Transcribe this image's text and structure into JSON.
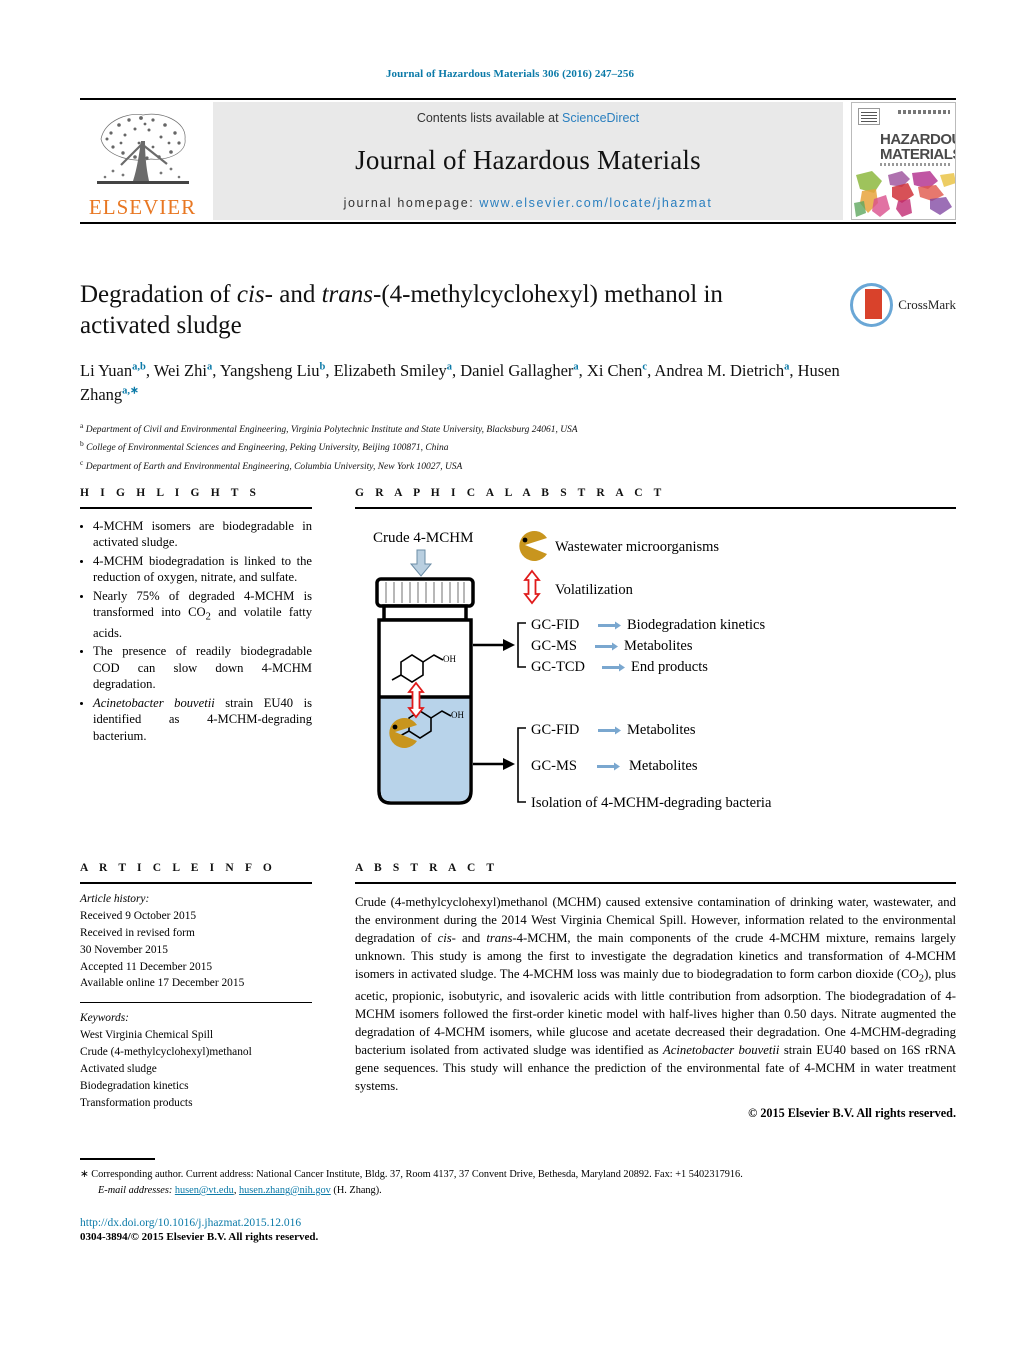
{
  "running_head": "Journal of Hazardous Materials 306 (2016) 247–256",
  "masthead": {
    "contents_prefix": "Contents lists available at ",
    "contents_link": "ScienceDirect",
    "journal_title": "Journal of Hazardous Materials",
    "homepage_label": "journal homepage: ",
    "homepage_url": "www.elsevier.com/locate/jhazmat",
    "publisher": "ELSEVIER",
    "cover_line1": "HAZARDOUS",
    "cover_line2": "MATERIALS"
  },
  "article": {
    "title_part1": "Degradation of ",
    "title_cis": "cis",
    "title_part2": "- and ",
    "title_trans": "trans",
    "title_part3": "-(4-methylcyclohexyl) methanol in activated sludge",
    "crossmark_label": "CrossMark",
    "authors_html": "Li Yuan<sup>a,b</sup>, Wei Zhi<sup>a</sup>, Yangsheng Liu<sup>b</sup>, Elizabeth Smiley<sup>a</sup>, Daniel Gallagher<sup>a</sup>, Xi Chen<sup>c</sup>, Andrea M. Dietrich<sup>a</sup>, Husen Zhang<sup>a,∗</sup>",
    "affiliations": [
      "Department of Civil and Environmental Engineering, Virginia Polytechnic Institute and State University, Blacksburg 24061, USA",
      "College of Environmental Sciences and Engineering, Peking University, Beijing 100871, China",
      "Department of Earth and Environmental Engineering, Columbia University, New York 10027, USA"
    ],
    "affil_marks": [
      "a",
      "b",
      "c"
    ]
  },
  "highlights": {
    "heading": "H I G H L I G H T S",
    "items_html": [
      "4-MCHM isomers are biodegradable in activated sludge.",
      "4-MCHM biodegradation is linked to the reduction of oxygen, nitrate, and sulfate.",
      "Nearly 75% of degraded 4-MCHM is transformed into CO<sub>2</sub> and volatile fatty acids.",
      "The presence of readily biodegradable COD can slow down 4-MCHM degradation.",
      "<i>Acinetobacter bouvetii</i> strain EU40 is identified as 4-MCHM-degrading bacterium."
    ]
  },
  "graphical_abstract": {
    "heading": "G R A P H I C A L   A B S T R A C T",
    "input_label": "Crude 4-MCHM",
    "legend": [
      {
        "icon": "pacman-microbe-icon",
        "label": "Wastewater microorganisms"
      },
      {
        "icon": "double-arrow-icon",
        "label": "Volatilization"
      }
    ],
    "headspace_analyses": [
      {
        "method": "GC-FID",
        "result": "Biodegradation kinetics"
      },
      {
        "method": "GC-MS",
        "result": "Metabolites"
      },
      {
        "method": "GC-TCD",
        "result": "End products"
      }
    ],
    "liquid_analyses": [
      {
        "method": "GC-FID",
        "result": "Metabolites"
      },
      {
        "method": "GC-MS",
        "result": "Metabolites"
      }
    ],
    "liquid_extra": "Isolation of 4-MCHM-degrading bacteria",
    "molecule_label": "OH",
    "colors": {
      "liquid": "#b8d3ea",
      "microbe": "#c8951e",
      "volatilization_arrow": "#e01b1b",
      "input_arrow": "#b9cfe0",
      "result_arrow": "#7aa7cf"
    }
  },
  "article_info": {
    "heading": "A R T I C L E   I N F O",
    "history_label": "Article history:",
    "history": [
      "Received 9 October 2015",
      "Received in revised form",
      "30 November 2015",
      "Accepted 11 December 2015",
      "Available online 17 December 2015"
    ],
    "keywords_label": "Keywords:",
    "keywords": [
      "West Virginia Chemical Spill",
      "Crude (4-methylcyclohexyl)methanol",
      "Activated sludge",
      "Biodegradation kinetics",
      "Transformation products"
    ]
  },
  "abstract": {
    "heading": "A B S T R A C T",
    "text_html": "Crude (4-methylcyclohexyl)methanol (MCHM) caused extensive contamination of drinking water, wastewater, and the environment during the 2014 West Virginia Chemical Spill. However, information related to the environmental degradation of <i>cis</i>- and <i>trans</i>-4-MCHM, the main components of the crude 4-MCHM mixture, remains largely unknown. This study is among the first to investigate the degradation kinetics and transformation of 4-MCHM isomers in activated sludge. The 4-MCHM loss was mainly due to biodegradation to form carbon dioxide (CO<sub>2</sub>), plus acetic, propionic, isobutyric, and isovaleric acids with little contribution from adsorption. The biodegradation of 4-MCHM isomers followed the first-order kinetic model with half-lives higher than 0.50 days. Nitrate augmented the degradation of 4-MCHM isomers, while glucose and acetate decreased their degradation. One 4-MCHM-degrading bacterium isolated from activated sludge was identified as <i>Acinetobacter bouvetii</i> strain EU40 based on 16S rRNA gene sequences. This study will enhance the prediction of the environmental fate of 4-MCHM in water treatment systems.",
    "copyright": "© 2015 Elsevier B.V. All rights reserved."
  },
  "footer": {
    "corresponding_star": "∗",
    "corresponding_text": "Corresponding author. Current address: National Cancer Institute, Bldg. 37, Room 4137, 37 Convent Drive, Bethesda, Maryland 20892. Fax: +1 5402317916.",
    "email_label": "E-mail addresses:",
    "email1": "husen@vt.edu",
    "email2": "husen.zhang@nih.gov",
    "email_suffix": "(H. Zhang).",
    "doi": "http://dx.doi.org/10.1016/j.jhazmat.2015.12.016",
    "issn": "0304-3894/© 2015 Elsevier B.V. All rights reserved."
  }
}
